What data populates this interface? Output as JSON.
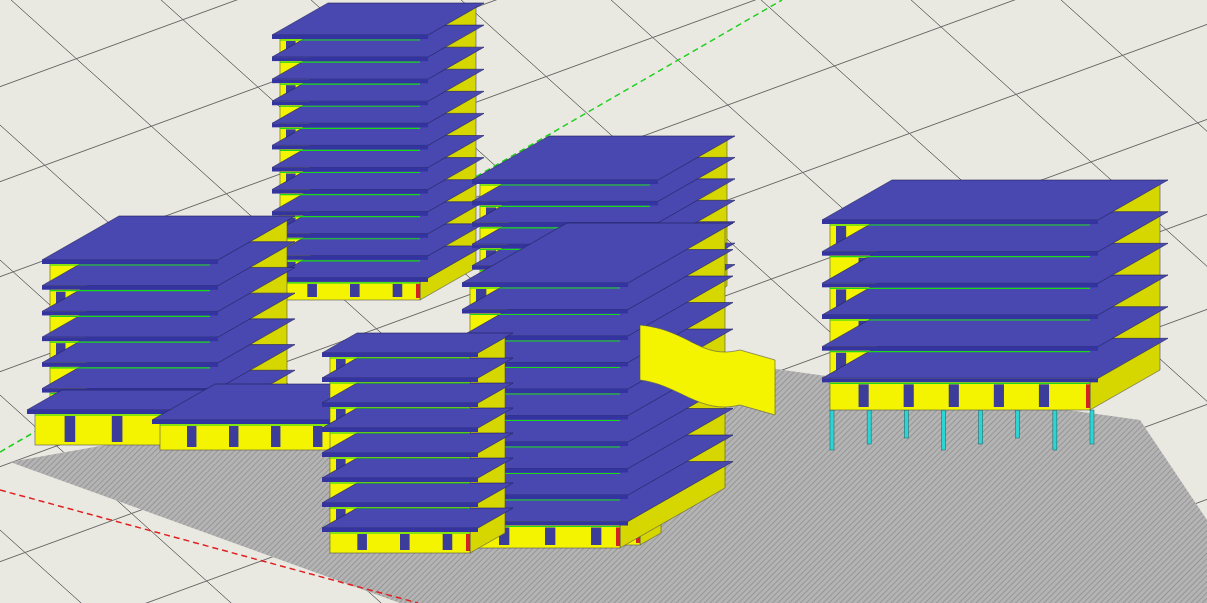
{
  "viewport": {
    "grid": true,
    "axes": true,
    "shadow": true
  }
}
